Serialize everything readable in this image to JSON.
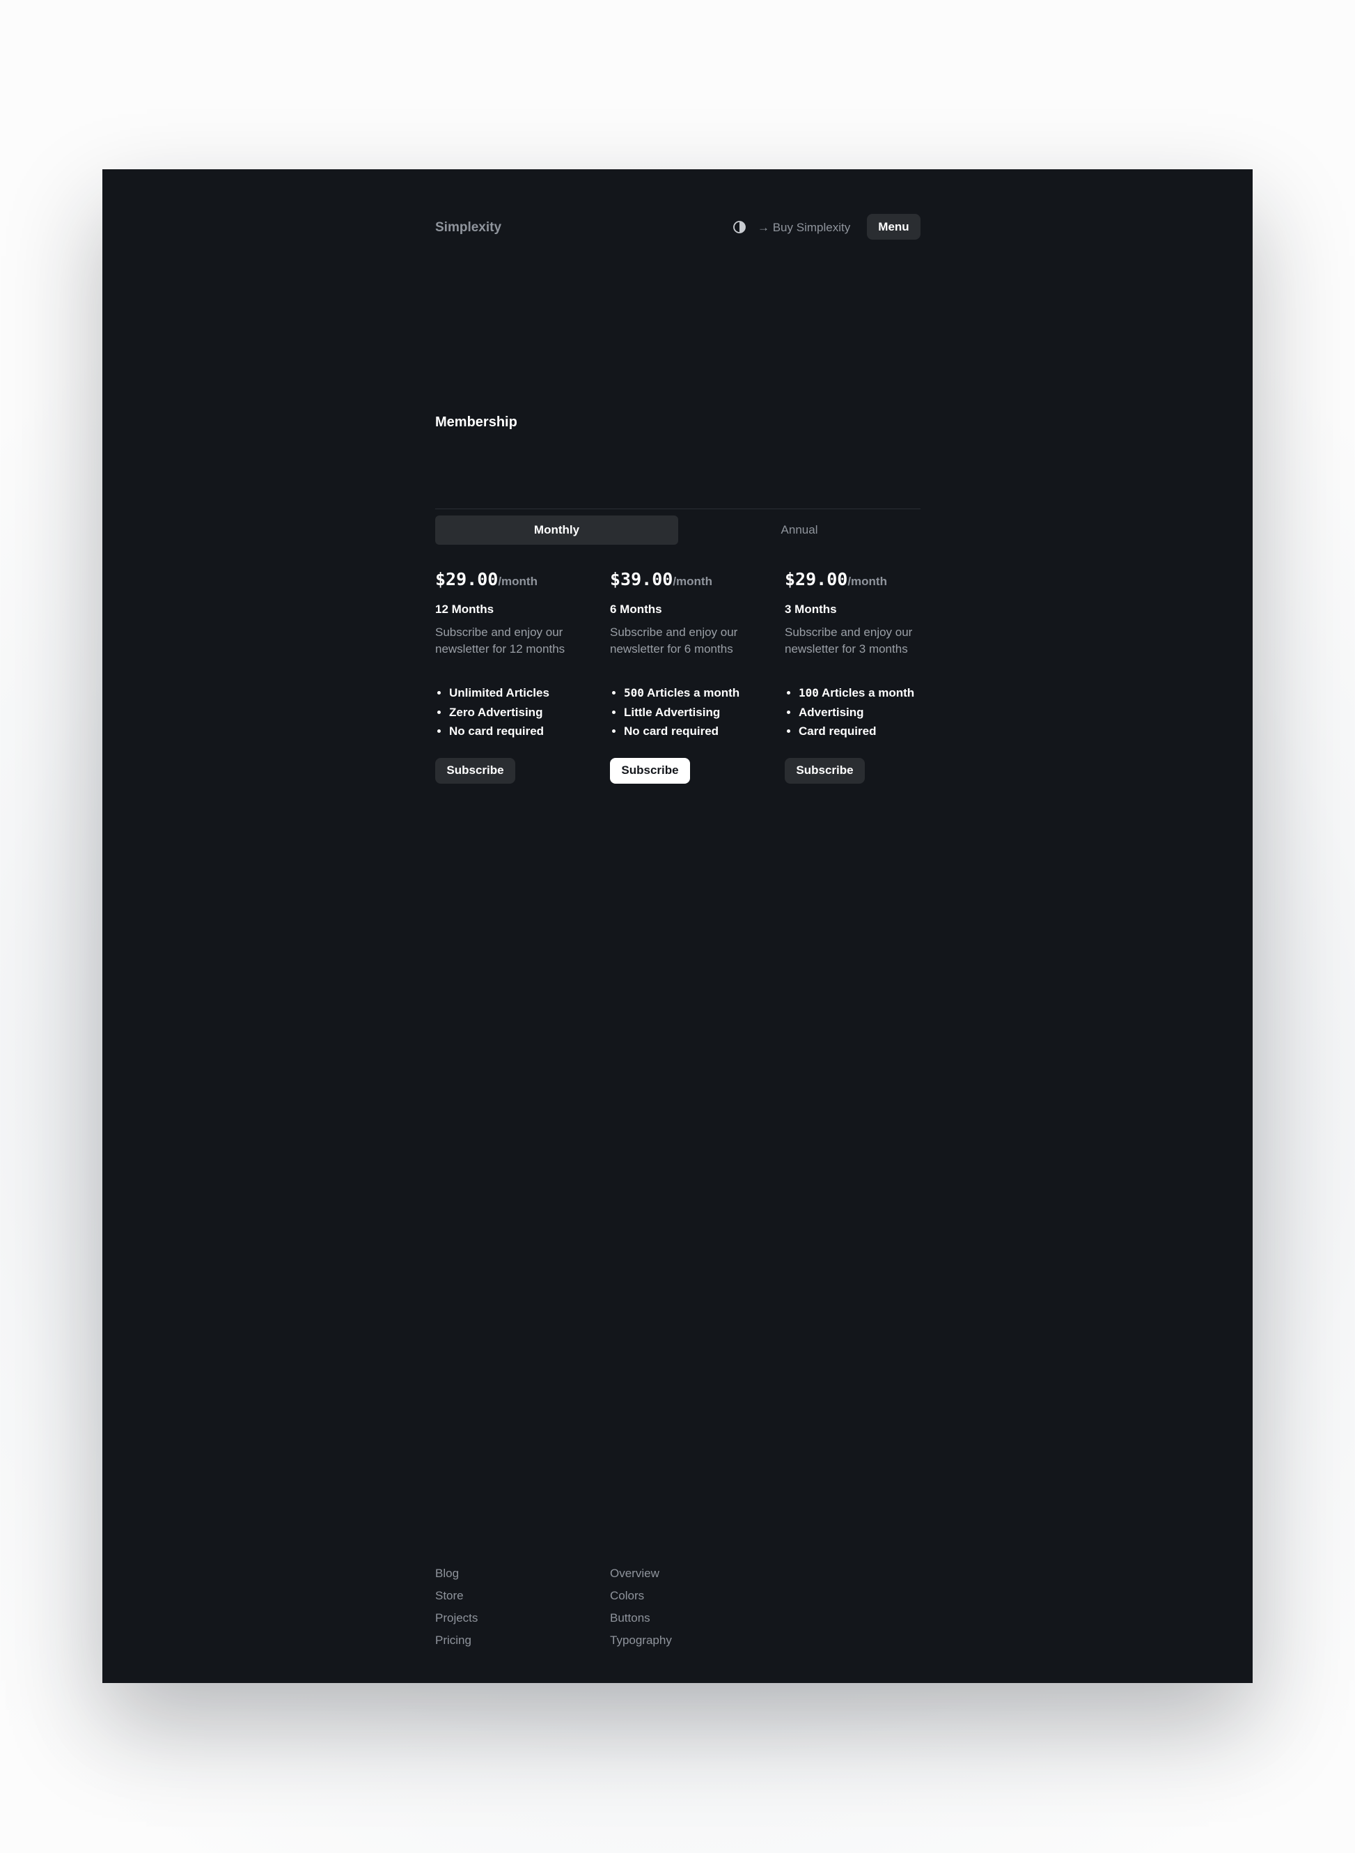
{
  "header": {
    "brand": "Simplexity",
    "theme_toggle_icon": "contrast-icon",
    "buy_link": "→ Buy Simplexity",
    "menu_label": "Menu"
  },
  "section": {
    "title": "Membership"
  },
  "tabs": [
    {
      "label": "Monthly",
      "selected": true
    },
    {
      "label": "Annual",
      "selected": false
    }
  ],
  "plans": [
    {
      "price": "$29.00",
      "period": "/month",
      "name": "12 Months",
      "description": "Subscribe and enjoy our newsletter for 12 months",
      "features": [
        {
          "prefix": "",
          "text": "Unlimited Articles"
        },
        {
          "prefix": "",
          "text": "Zero Advertising"
        },
        {
          "prefix": "",
          "text": "No card required"
        }
      ],
      "button": "Subscribe",
      "highlighted": false
    },
    {
      "price": "$39.00",
      "period": "/month",
      "name": "6 Months",
      "description": "Subscribe and enjoy our newsletter for 6 months",
      "features": [
        {
          "prefix": "500",
          "text": " Articles a month"
        },
        {
          "prefix": "",
          "text": "Little Advertising"
        },
        {
          "prefix": "",
          "text": "No card required"
        }
      ],
      "button": "Subscribe",
      "highlighted": true
    },
    {
      "price": "$29.00",
      "period": "/month",
      "name": "3 Months",
      "description": "Subscribe and enjoy our newsletter for 3 months",
      "features": [
        {
          "prefix": "100",
          "text": " Articles a month"
        },
        {
          "prefix": "",
          "text": "Advertising"
        },
        {
          "prefix": "",
          "text": "Card required"
        }
      ],
      "button": "Subscribe",
      "highlighted": false
    }
  ],
  "footer": {
    "col1": [
      "Blog",
      "Store",
      "Projects",
      "Pricing"
    ],
    "col2": [
      "Overview",
      "Colors",
      "Buttons",
      "Typography"
    ]
  },
  "colors": {
    "background": "#13161b",
    "surface": "#2a2d31",
    "text_primary": "#ffffff",
    "text_muted": "#8f949c"
  }
}
